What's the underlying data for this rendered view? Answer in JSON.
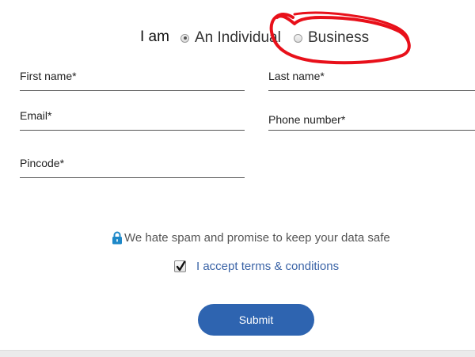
{
  "account_type": {
    "label": "I am",
    "options": [
      {
        "label": "An Individual",
        "selected": true
      },
      {
        "label": "Business",
        "selected": false
      }
    ]
  },
  "fields": {
    "first_name": "First name*",
    "last_name": "Last name*",
    "email": "Email*",
    "phone": "Phone number*",
    "pincode": "Pincode*"
  },
  "privacy_note": "We hate spam and promise to keep your data safe",
  "terms": {
    "label": "I accept terms & conditions",
    "checked": true
  },
  "submit_label": "Submit",
  "colors": {
    "accent": "#2e64b0",
    "link": "#3a63a6",
    "annotation": "#e8101a",
    "lock": "#1e88c8"
  },
  "icons": {
    "lock": "lock-icon",
    "check": "checkmark-icon"
  }
}
